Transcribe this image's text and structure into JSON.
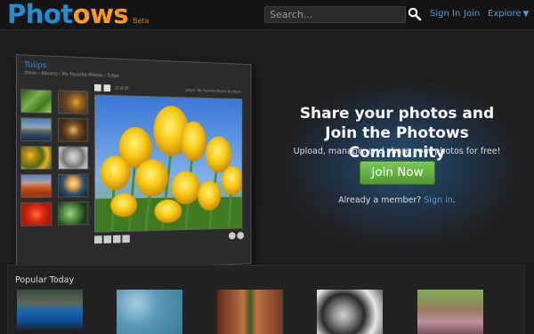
{
  "header": {
    "logo_text_1": "Phot",
    "logo_text_2": "ows",
    "beta": "Beta",
    "search_placeholder": "Search...",
    "nav": {
      "sign_in": "Sign In",
      "join": "Join",
      "explore": "Explore",
      "explore_caret": "▼"
    }
  },
  "preview": {
    "album_title": "Tulips",
    "breadcrumb": "steve › Albums › My Favorite Photos › Tulips",
    "counter": "12 of 20",
    "photo_label": "album: My Favorite Photos by steve",
    "thumbnails": [
      "grass",
      "bee",
      "mountain lake",
      "insect on flower",
      "sunflowers",
      "koala",
      "desert sunset",
      "jellyfish",
      "red flower",
      "green leaves"
    ]
  },
  "hero": {
    "title_line1": "Share your photos and",
    "title_line2": "Join the Photows Community",
    "subtitle": "Upload, manage, and share your photos for free!",
    "join_button": "Join Now",
    "member_text": "Already a member?",
    "member_link": "Sign in",
    "member_period": "."
  },
  "popular": {
    "title": "Popular Today",
    "photos": [
      "blue car",
      "water droplets",
      "christmas tree",
      "tire",
      "people"
    ]
  },
  "colors": {
    "brand_blue": "#1e8fd5",
    "brand_orange": "#ff9a1a",
    "link": "#4a9fe0",
    "join_green": "#5fae3c"
  }
}
